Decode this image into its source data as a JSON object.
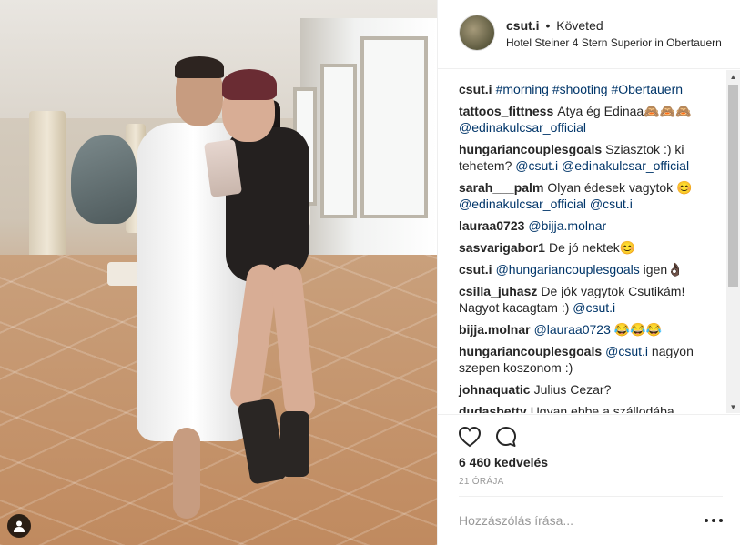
{
  "header": {
    "username": "csut.i",
    "separator": "•",
    "follow_status": "Követed",
    "location": "Hotel Steiner 4 Stern Superior in Obertauern"
  },
  "comments": [
    {
      "user": "csut.i",
      "parts": [
        {
          "text": "#morning #shooting #Obertauern",
          "link": true
        }
      ]
    },
    {
      "user": "tattoos_fittness",
      "parts": [
        {
          "text": "Atya ég Edinaa🙈🙈🙈 ",
          "link": false
        },
        {
          "text": "@edinakulcsar_official",
          "link": true
        }
      ]
    },
    {
      "user": "hungariancouplesgoals",
      "parts": [
        {
          "text": "Sziasztok :) ki tehetem? ",
          "link": false
        },
        {
          "text": "@csut.i @edinakulcsar_official",
          "link": true
        }
      ]
    },
    {
      "user": "sarah___palm",
      "parts": [
        {
          "text": "Olyan édesek vagytok 😊 ",
          "link": false
        },
        {
          "text": "@edinakulcsar_official @csut.i",
          "link": true
        }
      ]
    },
    {
      "user": "lauraa0723",
      "parts": [
        {
          "text": "@bijja.molnar",
          "link": true
        }
      ]
    },
    {
      "user": "sasvarigabor1",
      "parts": [
        {
          "text": "De jó nektek😊",
          "link": false
        }
      ]
    },
    {
      "user": "csut.i",
      "parts": [
        {
          "text": "@hungariancouplesgoals",
          "link": true
        },
        {
          "text": " igen👌🏿",
          "link": false
        }
      ]
    },
    {
      "user": "csilla_juhasz",
      "parts": [
        {
          "text": "De jók vagytok Csutikám! Nagyot kacagtam :) ",
          "link": false
        },
        {
          "text": "@csut.i",
          "link": true
        }
      ]
    },
    {
      "user": "bijja.molnar",
      "parts": [
        {
          "text": "@lauraa0723",
          "link": true
        },
        {
          "text": " 😂😂😂",
          "link": false
        }
      ]
    },
    {
      "user": "hungariancouplesgoals",
      "parts": [
        {
          "text": "@csut.i",
          "link": true
        },
        {
          "text": " nagyon szepen koszonom :)",
          "link": false
        }
      ]
    },
    {
      "user": "johnaquatic",
      "parts": [
        {
          "text": "Julius Cezar?",
          "link": false
        }
      ]
    },
    {
      "user": "dudasbetty",
      "parts": [
        {
          "text": "Ugyan ebbe a szállodába",
          "link": false
        }
      ]
    }
  ],
  "actions": {
    "like_icon": "heart-outline-icon",
    "comment_icon": "speech-bubble-icon",
    "likes_text": "6 460 kedvelés",
    "time_text": "21 ÓRÁJA"
  },
  "add_comment": {
    "placeholder": "Hozzászólás írása..."
  },
  "photo": {
    "tag_icon": "person-tag-icon"
  },
  "colors": {
    "link": "#003569",
    "text": "#262626",
    "muted": "#999999",
    "border": "#efefef"
  }
}
